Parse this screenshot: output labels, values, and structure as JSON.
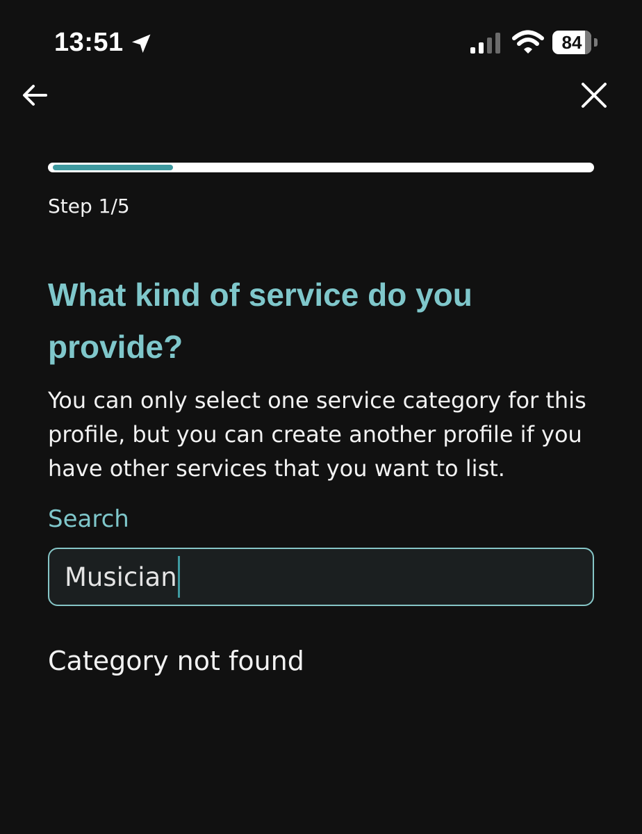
{
  "status_bar": {
    "time": "13:51",
    "battery_level": "84",
    "battery_fraction": 0.84,
    "icons": [
      "location-arrow-icon",
      "cellular-signal-icon",
      "wifi-icon",
      "battery-icon"
    ]
  },
  "nav": {
    "back_icon": "arrow-left-icon",
    "close_icon": "close-icon"
  },
  "progress": {
    "current_step": 1,
    "total_steps": 5,
    "step_label": "Step 1/5"
  },
  "question": {
    "title": "What kind of service do you provide?",
    "description": "You can only select one service category for this profile, but you can create another profile if you have other services that you want to list."
  },
  "search": {
    "label": "Search",
    "value": "Musician"
  },
  "results": {
    "empty_message": "Category not found"
  },
  "colors": {
    "background": "#111111",
    "accent": "#7fc7cb",
    "progress_fill": "#3f9aa0",
    "text": "#f2f2f2"
  }
}
